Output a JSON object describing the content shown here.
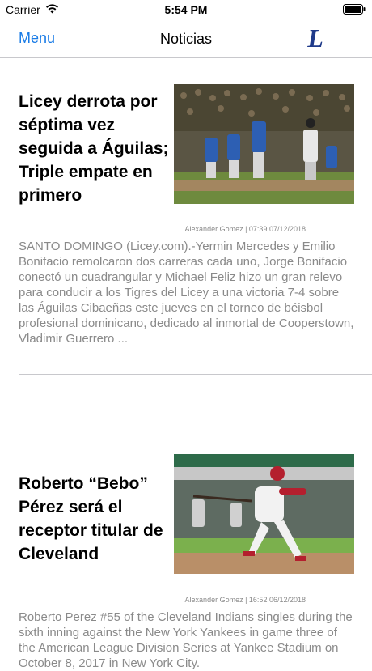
{
  "status_bar": {
    "carrier": "Carrier",
    "time": "5:54 PM"
  },
  "nav": {
    "menu_label": "Menu",
    "title": "Noticias",
    "logo_letter": "L"
  },
  "articles": [
    {
      "title": "Licey derrota por séptima vez seguida a Águilas; Triple empate en primero",
      "byline": "Alexander Gomez | 07:39 07/12/2018",
      "excerpt": "SANTO DOMINGO (Licey.com).-Yermin Mercedes y Emilio Bonifacio remolcaron dos carreras cada uno, Jorge Bonifacio conectó un cuadrangular y Michael Feliz hizo un gran relevo para conducir a los Tigres del Licey a una victoria  7-4 sobre las Águilas Cibaeñas  este jueves en el torneo de béisbol profesional dominicano, dedicado al inmortal de Cooperstown, Vladimir Guerrero ..."
    },
    {
      "title": "Roberto “Bebo” Pérez será el receptor titular de Cleveland",
      "byline": "Alexander Gomez | 16:52 06/12/2018",
      "excerpt": "Roberto Perez #55 of the Cleveland Indians singles during the sixth inning against the New York Yankees in game three of the American League Division Series at Yankee Stadium on October 8, 2017 in New York City."
    }
  ],
  "colors": {
    "accent": "#1a7ce6",
    "logo": "#1f3a8a",
    "meta_text": "#8a8a8a",
    "divider": "#c8c8cc"
  },
  "icons": {
    "wifi": "wifi-icon",
    "battery": "battery-icon"
  }
}
